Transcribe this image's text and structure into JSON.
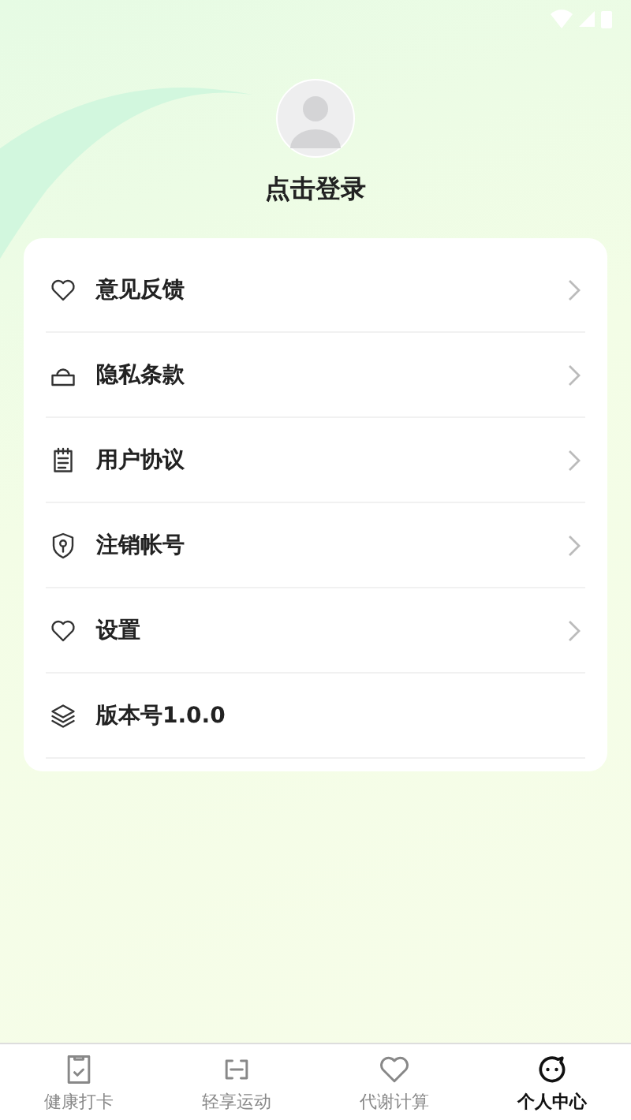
{
  "profile": {
    "login_label": "点击登录"
  },
  "menu": [
    {
      "kind": "heart",
      "label": "意见反馈",
      "arrow": true
    },
    {
      "kind": "lock",
      "label": "隐私条款",
      "arrow": true
    },
    {
      "kind": "clipboard",
      "label": "用户协议",
      "arrow": true
    },
    {
      "kind": "shield",
      "label": "注销帐号",
      "arrow": true
    },
    {
      "kind": "heart",
      "label": "设置",
      "arrow": true
    },
    {
      "kind": "layers",
      "label": "版本号1.0.0",
      "arrow": false
    }
  ],
  "tabs": [
    {
      "kind": "checkin",
      "label": "健康打卡",
      "selected": false
    },
    {
      "kind": "sport",
      "label": "轻享运动",
      "selected": false
    },
    {
      "kind": "heart",
      "label": "代谢计算",
      "selected": false
    },
    {
      "kind": "face",
      "label": "个人中心",
      "selected": true
    }
  ]
}
